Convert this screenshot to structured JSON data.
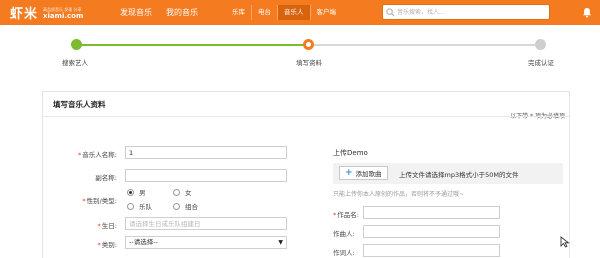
{
  "header": {
    "logo_main": "虾米",
    "logo_tagline": "高品质音乐 发现 分享",
    "logo_domain": "xiami.com",
    "nav": [
      "发现音乐",
      "我的音乐"
    ],
    "subnav": [
      {
        "label": "乐库",
        "active": false
      },
      {
        "label": "电台",
        "active": false
      },
      {
        "label": "音乐人",
        "active": true
      },
      {
        "label": "客户端",
        "active": false
      }
    ],
    "search_placeholder": "音乐搜索，找人...",
    "colors": {
      "brand": "#f47b20",
      "active_tab": "#d8630d"
    }
  },
  "steps": [
    {
      "label": "搜索艺人",
      "status": "done"
    },
    {
      "label": "填写资料",
      "status": "current"
    },
    {
      "label": "完成认证",
      "status": "todo"
    }
  ],
  "form": {
    "title": "填写音乐人资料",
    "required_note": "以下带 * 项为必填项",
    "name_label": "音乐人名称:",
    "name_value": "1",
    "alias_label": "副名称:",
    "alias_value": "",
    "gender_label": "性别/类型:",
    "gender_options": [
      {
        "label": "男",
        "checked": true
      },
      {
        "label": "女",
        "checked": false
      },
      {
        "label": "乐队",
        "checked": false
      },
      {
        "label": "组合",
        "checked": false
      }
    ],
    "birthday_label": "生日:",
    "birthday_placeholder": "请选择生日或乐队组建日",
    "category_label": "类别:",
    "category_value": "--请选择--"
  },
  "demo": {
    "title": "上传Demo",
    "add_button": "添加歌曲",
    "hint": "上传文件请选择mp3格式小于50M的文件",
    "note": "只能上传你本人原创的作品，否则将不予通过哦~",
    "fields": [
      {
        "label": "作品名:",
        "required": true,
        "value": ""
      },
      {
        "label": "作曲人:",
        "required": false,
        "value": ""
      },
      {
        "label": "作词人:",
        "required": false,
        "value": ""
      }
    ]
  }
}
